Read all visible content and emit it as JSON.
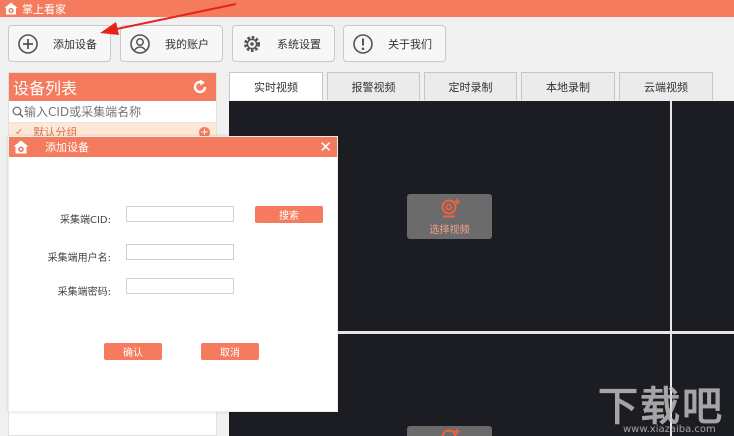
{
  "app": {
    "title": "掌上看家"
  },
  "toolbar": {
    "add_device": "添加设备",
    "my_account": "我的账户",
    "system_settings": "系统设置",
    "about_us": "关于我们"
  },
  "sidebar": {
    "title": "设备列表",
    "search_placeholder": "输入CID或采集端名称",
    "group_label": "默认分组"
  },
  "tabs": [
    {
      "label": "实时视频",
      "active": true
    },
    {
      "label": "报警视频",
      "active": false
    },
    {
      "label": "定时录制",
      "active": false
    },
    {
      "label": "本地录制",
      "active": false
    },
    {
      "label": "云端视频",
      "active": false
    }
  ],
  "video": {
    "select_label": "选择视频"
  },
  "dialog": {
    "title": "添加设备",
    "cid_label": "采集端CID:",
    "cid_value": "",
    "search_button": "搜索",
    "username_label": "采集端用户名:",
    "username_value": "",
    "password_label": "采集端密码:",
    "password_value": "",
    "confirm_button": "确认",
    "cancel_button": "取消"
  },
  "watermark": {
    "text": "下载吧",
    "url": "www.xiazaiba.com"
  },
  "colors": {
    "accent": "#f47b5e",
    "video_bg": "#1c1d22",
    "annotation_arrow": "#e8231a"
  },
  "icons": {
    "titlebar": "home-eye-icon",
    "add_device": "plus-circle-icon",
    "my_account": "user-circle-icon",
    "system_settings": "gear-icon",
    "about_us": "info-circle-icon",
    "refresh": "refresh-icon",
    "search": "search-icon",
    "select_video": "camera-plus-icon"
  }
}
